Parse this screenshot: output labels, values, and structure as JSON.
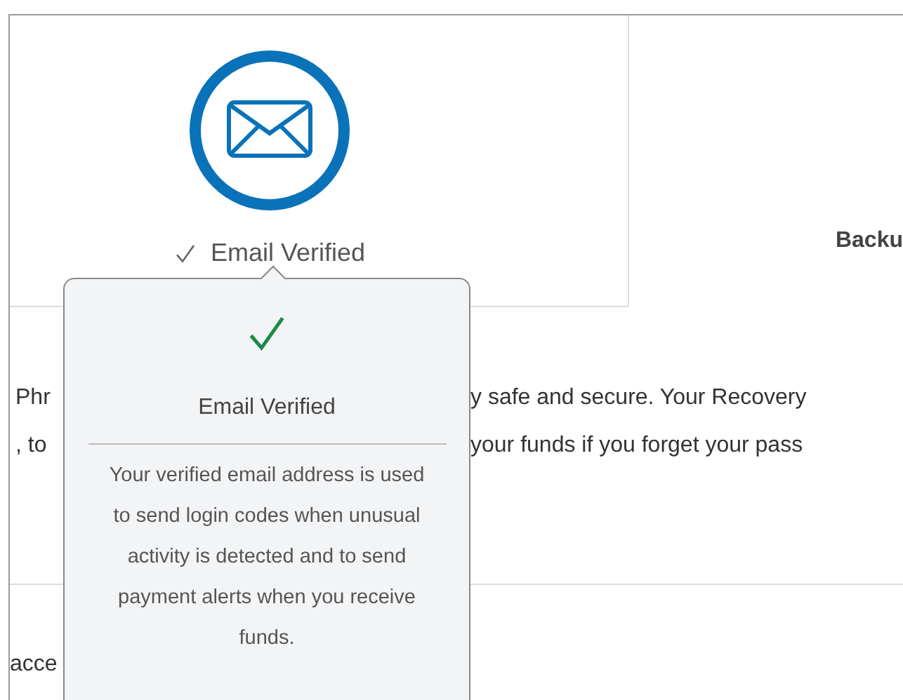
{
  "card": {
    "verified": true,
    "label": "Email Verified"
  },
  "side_heading": "Backu",
  "paragraph_lines": [
    {
      "left": "Phr",
      "right": "y safe and secure. Your Recovery"
    },
    {
      "left": ", to",
      "right": "your funds if you forget your pass"
    }
  ],
  "section_text": "acce",
  "tooltip": {
    "verified": true,
    "title": "Email Verified",
    "body": "Your verified email address is used to send login codes when unusual activity is detected and to send payment alerts when you receive funds."
  }
}
